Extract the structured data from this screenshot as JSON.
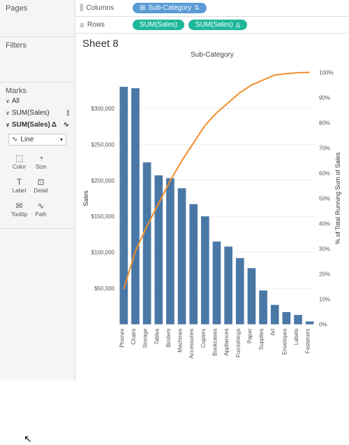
{
  "panels": {
    "pages": "Pages",
    "filters": "Filters",
    "marks": "Marks"
  },
  "marks": {
    "all": "All",
    "series1": "SUM(Sales)",
    "series2": "SUM(Sales)",
    "series2_suffix": "Δ",
    "type_label": "Line",
    "buttons": {
      "color": "Color",
      "size": "Size",
      "label": "Label",
      "detail": "Detail",
      "tooltip": "Tooltip",
      "path": "Path"
    }
  },
  "shelves": {
    "columns_label": "Columns",
    "rows_label": "Rows",
    "columns_pill": "Sub-Category",
    "rows_pill1": "SUM(Sales)",
    "rows_pill2": "SUM(Sales)"
  },
  "sheet": {
    "title": "Sheet 8"
  },
  "chart_data": {
    "type": "bar",
    "title": "Sub-Category",
    "ylabel": "Sales",
    "y2label": "% of Total Running Sum of Sales",
    "ylim": [
      0,
      350000
    ],
    "y2lim": [
      0,
      100
    ],
    "yticks": [
      50000,
      100000,
      150000,
      200000,
      250000,
      300000
    ],
    "ytick_labels": [
      "$50,000",
      "$100,000",
      "$150,000",
      "$200,000",
      "$250,000",
      "$300,000"
    ],
    "y2ticks": [
      0,
      10,
      20,
      30,
      40,
      50,
      60,
      70,
      80,
      90,
      100
    ],
    "y2tick_labels": [
      "0%",
      "10%",
      "20%",
      "30%",
      "40%",
      "50%",
      "60%",
      "70%",
      "80%",
      "90%",
      "100%"
    ],
    "categories": [
      "Phones",
      "Chairs",
      "Storage",
      "Tables",
      "Binders",
      "Machines",
      "Accessories",
      "Copiers",
      "Bookcases",
      "Appliances",
      "Furnishings",
      "Paper",
      "Supplies",
      "Art",
      "Envelopes",
      "Labels",
      "Fasteners"
    ],
    "series": [
      {
        "name": "Sales",
        "type": "bar",
        "color": "#4a78a6",
        "values": [
          330000,
          328000,
          225000,
          207000,
          203000,
          189000,
          167000,
          150000,
          115000,
          108000,
          92000,
          78000,
          47000,
          27000,
          17000,
          13000,
          4000
        ]
      },
      {
        "name": "Running %",
        "type": "line",
        "color": "#f28e2b",
        "values": [
          14,
          29,
          39,
          48,
          57,
          65,
          72,
          79,
          84,
          88,
          92,
          95,
          97,
          99,
          99.5,
          99.9,
          100
        ]
      }
    ]
  }
}
